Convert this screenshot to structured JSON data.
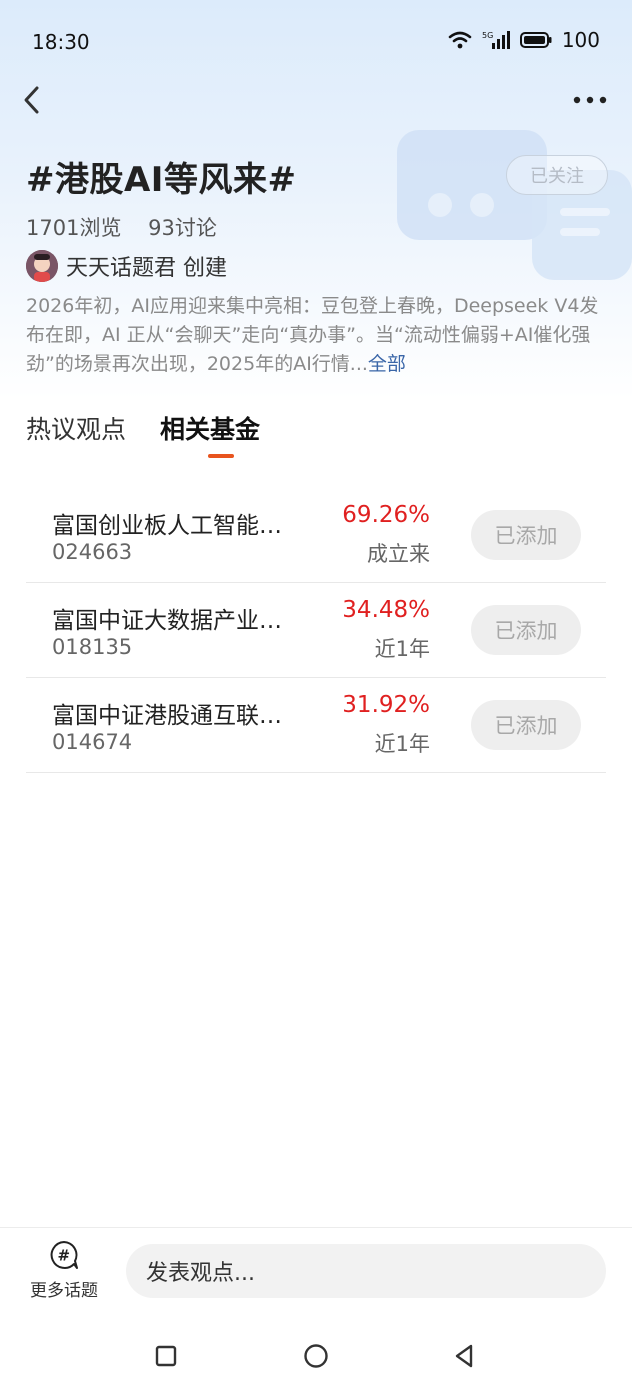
{
  "status_bar": {
    "time": "18:30",
    "network": "5G",
    "battery": "100"
  },
  "topic": {
    "title": "#港股AI等风来#",
    "follow_label": "已关注",
    "views": "1701浏览",
    "discussions": "93讨论",
    "creator": "天天话题君 创建",
    "description": "2026年初，AI应用迎来集中亮相：豆包登上春晚，Deepseek V4发布在即，AI 正从“会聊天”走向“真办事”。当“流动性偏弱+AI催化强劲”的场景再次出现，2025年的AI行情...",
    "more_label": "全部"
  },
  "tabs": [
    {
      "label": "热议观点",
      "active": false
    },
    {
      "label": "相关基金",
      "active": true
    }
  ],
  "funds": [
    {
      "name": "富国创业板人工智能…",
      "code": "024663",
      "return": "69.26%",
      "period": "成立来",
      "button": "已添加"
    },
    {
      "name": "富国中证大数据产业…",
      "code": "018135",
      "return": "34.48%",
      "period": "近1年",
      "button": "已添加"
    },
    {
      "name": "富国中证港股通互联…",
      "code": "014674",
      "return": "31.92%",
      "period": "近1年",
      "button": "已添加"
    }
  ],
  "bottom_bar": {
    "more_topics_label": "更多话题",
    "comment_placeholder": "发表观点..."
  },
  "colors": {
    "accent": "#e8541e",
    "return_red": "#e02020",
    "link_blue": "#3a66a8"
  }
}
